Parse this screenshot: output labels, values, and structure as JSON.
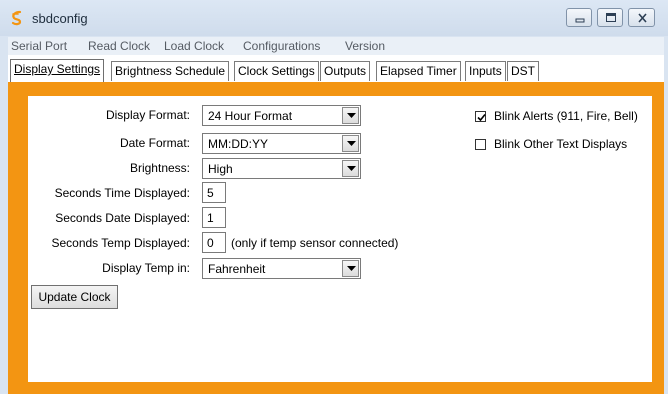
{
  "window": {
    "title": "sbdconfig"
  },
  "menu": [
    "Serial Port",
    "Read Clock",
    "Load Clock",
    "Configurations",
    "Version"
  ],
  "tabs": [
    {
      "label": "Display Settings",
      "active": true
    },
    {
      "label": "Brightness Schedule",
      "active": false
    },
    {
      "label": "Clock Settings",
      "active": false
    },
    {
      "label": "Outputs",
      "active": false
    },
    {
      "label": "Elapsed Timer",
      "active": false
    },
    {
      "label": "Inputs",
      "active": false
    },
    {
      "label": "DST",
      "active": false
    }
  ],
  "form": {
    "display_format": {
      "label": "Display Format:",
      "value": "24 Hour Format"
    },
    "date_format": {
      "label": "Date Format:",
      "value": "MM:DD:YY"
    },
    "brightness": {
      "label": "Brightness:",
      "value": "High"
    },
    "seconds_time": {
      "label": "Seconds Time Displayed:",
      "value": "5"
    },
    "seconds_date": {
      "label": "Seconds Date Displayed:",
      "value": "1"
    },
    "seconds_temp": {
      "label": "Seconds Temp Displayed:",
      "value": "0",
      "note": "(only if temp sensor connected)"
    },
    "temp_unit": {
      "label": "Display Temp in:",
      "value": "Fahrenheit"
    }
  },
  "checkboxes": {
    "blink_alerts": {
      "label": "Blink Alerts (911, Fire, Bell)",
      "checked": true
    },
    "blink_other": {
      "label": "Blink Other Text Displays",
      "checked": false
    }
  },
  "buttons": {
    "update_clock": "Update Clock"
  },
  "colors": {
    "panel_accent": "#f39512",
    "titlebar": "#d6e2f0"
  },
  "icons": {
    "app": "sbdconfig-logo-icon",
    "minimize": "minimize-icon",
    "maximize": "maximize-icon",
    "close": "close-icon"
  }
}
